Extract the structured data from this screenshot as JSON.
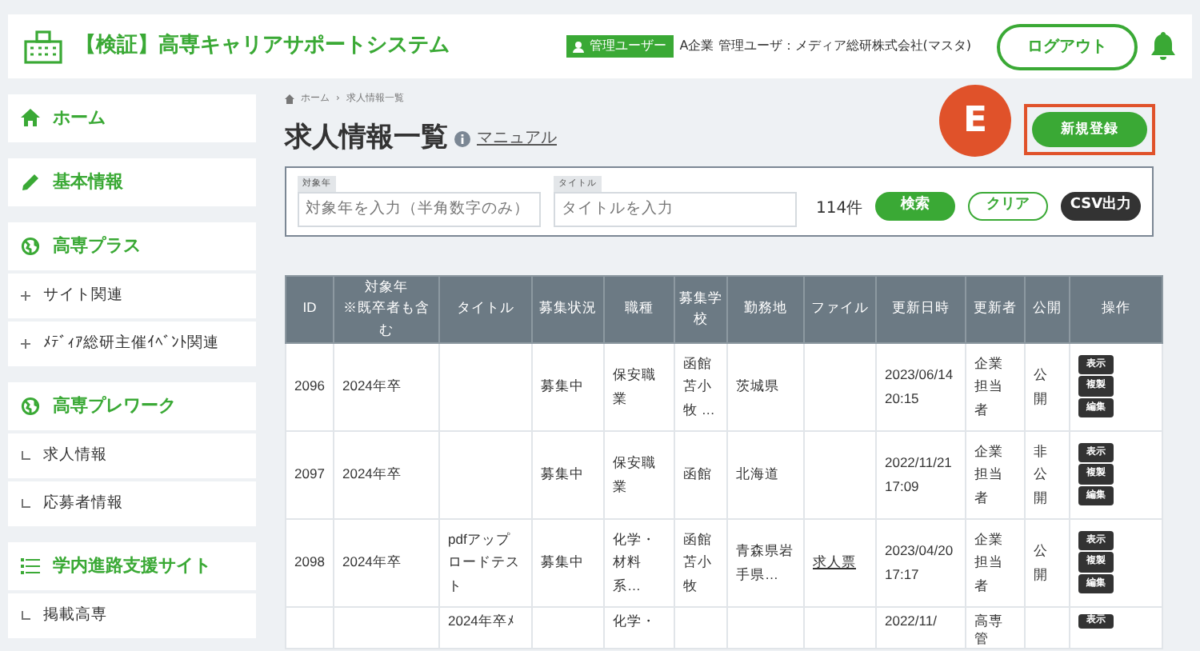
{
  "header": {
    "title": "【検証】高専キャリアサポートシステム",
    "role_badge": "管理ユーザー",
    "user": "A企業 管理ユーザ：メディア総研株式会社(マスタ)",
    "logout": "ログアウト"
  },
  "sidebar": {
    "groups": [
      {
        "label": "ホーム"
      },
      {
        "label": "基本情報"
      },
      {
        "label": "高専プラス",
        "items": [
          {
            "label": "サイト関連",
            "kind": "plus"
          },
          {
            "label": "ﾒﾃﾞｨｱ総研主催ｲﾍﾞﾝﾄ関連",
            "kind": "plus"
          }
        ]
      },
      {
        "label": "高専プレワーク",
        "items": [
          {
            "label": "求人情報",
            "kind": "branch"
          },
          {
            "label": "応募者情報",
            "kind": "branch"
          }
        ]
      },
      {
        "label": "学内進路支援サイト",
        "items": [
          {
            "label": "掲載高専",
            "kind": "branch"
          }
        ]
      }
    ]
  },
  "breadcrumb": {
    "items": [
      "ホーム",
      "求人情報一覧"
    ],
    "separator": "›"
  },
  "page_title": "求人情報一覧",
  "manual_link": "マニュアル",
  "annotation": {
    "label": "E"
  },
  "new_button": {
    "label": "新規登録",
    "highlighted": true
  },
  "filters": [
    {
      "label": "対象年",
      "placeholder": "対象年を入力（半角数字のみ）"
    },
    {
      "label": "タイトル",
      "placeholder": "タイトルを入力"
    }
  ],
  "count": "114件",
  "actions": [
    {
      "label": "検索",
      "kind": "primary"
    },
    {
      "label": "クリア",
      "kind": "outline"
    },
    {
      "label": "CSV出力",
      "kind": "dark"
    }
  ],
  "table": {
    "columns": [
      "ID",
      "対象年\n※既卒者も含む",
      "タイトル",
      "募集状況",
      "職種",
      "募集学校",
      "勤務地",
      "ファイル",
      "更新日時",
      "更新者",
      "公開",
      "操作"
    ],
    "rows": [
      {
        "cells": [
          "2096",
          "2024年卒",
          "",
          "募集中",
          "保安職業",
          "函館苫小牧 …",
          "茨城県",
          "",
          "2023/06/14 20:15",
          "企業担当者",
          "公開"
        ],
        "ops": [
          "表示",
          "複製",
          "編集"
        ]
      },
      {
        "cells": [
          "2097",
          "2024年卒",
          "",
          "募集中",
          "保安職業",
          "函館",
          "北海道",
          "",
          "2022/11/21 17:09",
          "企業担当者",
          "非公開"
        ],
        "ops": [
          "表示",
          "複製",
          "編集"
        ]
      },
      {
        "cells": [
          "2098",
          "2024年卒",
          "pdfアップロードテスト",
          "募集中",
          "化学・材料系…",
          "函館苫小牧",
          "青森県岩手県…",
          "求人票",
          "2023/04/20 17:17",
          "企業担当者",
          "公開"
        ],
        "ops": [
          "表示",
          "複製",
          "編集"
        ]
      }
    ],
    "partial_row": {
      "title": "2024年卒ﾒ",
      "job": "化学・",
      "updated": "2022/11/",
      "updater": "高専管",
      "ops": [
        "表示"
      ]
    }
  }
}
